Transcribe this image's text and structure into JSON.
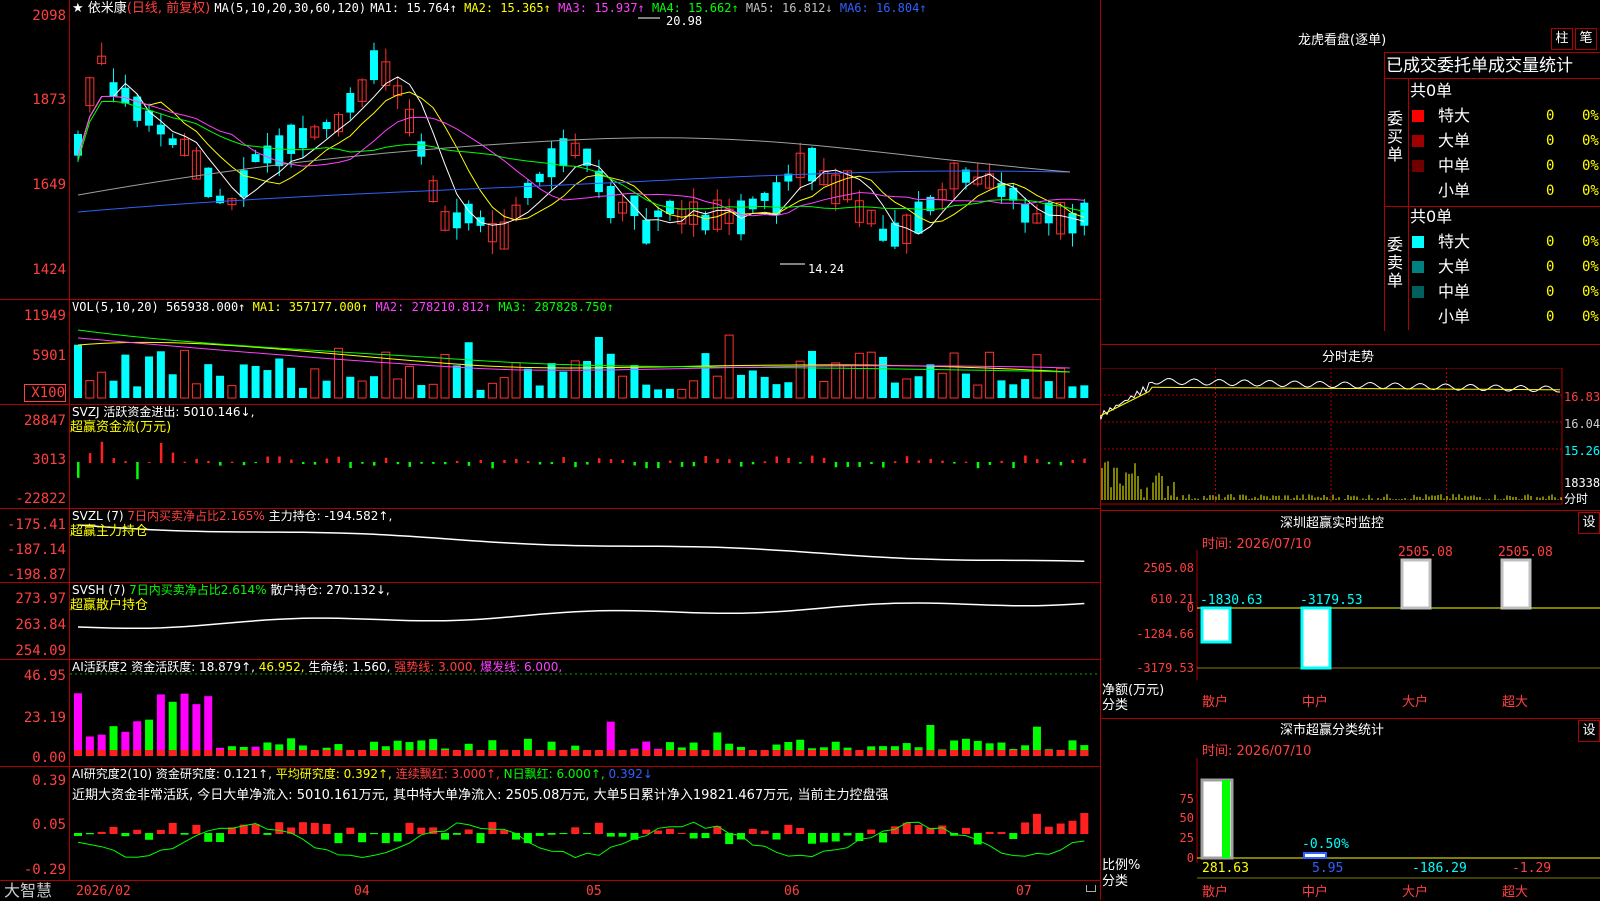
{
  "header": {
    "star": "★",
    "stock_name": "依米康",
    "mode": "(日线, 前复权)",
    "ma_label": "MA(5,10,20,30,60,120)",
    "ma_values": [
      {
        "label": "MA1:",
        "value": "15.764↑",
        "color": "#ffffff"
      },
      {
        "label": "MA2:",
        "value": "15.365↑",
        "color": "#ffff00"
      },
      {
        "label": "MA3:",
        "value": "15.937↑",
        "color": "#ff40ff"
      },
      {
        "label": "MA4:",
        "value": "15.662↑",
        "color": "#00ff00"
      },
      {
        "label": "MA5:",
        "value": "16.812↓",
        "color": "#c0c0c0"
      },
      {
        "label": "MA6:",
        "value": "16.804↑",
        "color": "#3060ff"
      }
    ],
    "high_label": "20.98",
    "low_label": "14.24"
  },
  "price_axis": [
    "2098",
    "1873",
    "1649",
    "1424"
  ],
  "vol": {
    "title": "VOL(5,10,20)",
    "value": "565938.000↑",
    "ma1": "MA1: 357177.000↑",
    "ma2": "MA2: 278210.812↑",
    "ma3": "MA3: 287828.750↑",
    "axis": [
      "11949",
      "5901",
      "X100"
    ]
  },
  "svzj": {
    "title": "SVZJ",
    "label": "活跃资金进出: 5010.146↓,",
    "sub": "超赢资金流(万元)",
    "axis": [
      "28847",
      "3013",
      "-22822"
    ]
  },
  "svzl": {
    "title": "SVZL (7)",
    "ratio": "7日内买卖净占比2.165%",
    "label": "主力持仓: -194.582↑,",
    "sub": "超赢主力持仓",
    "axis": [
      "-175.41",
      "-187.14",
      "-198.87"
    ]
  },
  "svsh": {
    "title": "SVSH (7)",
    "ratio": "7日内买卖净占比2.614%",
    "label": "散户持仓: 270.132↓,",
    "sub": "超赢散户持仓",
    "axis": [
      "273.97",
      "263.84",
      "254.09"
    ]
  },
  "ai_active": {
    "title": "AI活跃度2",
    "label": "资金活跃度: 18.879↑,",
    "v2": "46.952,",
    "life": "生命线: 1.560,",
    "strong": "强势线: 3.000,",
    "burst": "爆发线: 6.000,",
    "axis": [
      "46.95",
      "23.19",
      "0.00"
    ]
  },
  "ai_research": {
    "title": "AI研究度2(10)",
    "label": "资金研究度: 0.121↑,",
    "avg": "平均研究度: 0.392↑,",
    "cont": "连续飘红: 3.000↑,",
    "nday": "N日飘红: 6.000↑,",
    "last": "0.392↓",
    "comment": "近期大资金非常活跃, 今日大单净流入: 5010.161万元, 其中特大单净流入: 2505.08万元, 大单5日累计净入19821.467万元, 当前主力控盘强",
    "axis": [
      "0.39",
      "0.05",
      "-0.29"
    ]
  },
  "xaxis": {
    "brand": "大智慧",
    "labels": [
      "2026/02",
      "04",
      "05",
      "06",
      "07"
    ]
  },
  "dragon": {
    "title": "龙虎看盘(逐单)",
    "btn1": "柱",
    "btn2": "笔",
    "subtitle": "已成交委托单成交量统计",
    "buy_side": "委买单",
    "sell_side": "委卖单",
    "buy_total": "共0单",
    "sell_total": "共0单",
    "rows": [
      "特大",
      "大单",
      "中单",
      "小单"
    ],
    "qty": "0",
    "pct": "0%"
  },
  "intraday": {
    "title": "分时走势",
    "axis": [
      "16.83",
      "16.04",
      "15.26",
      "18338",
      "分时"
    ]
  },
  "sz_monitor": {
    "title": "深圳超赢实时监控",
    "settings": "设",
    "time": "时间: 2026/07/10",
    "axis": [
      "2505.08",
      "610.21",
      "0",
      "-1284.66",
      "-3179.53"
    ],
    "ylabel": "净额(万元)",
    "xlabel": "分类",
    "bars": [
      {
        "cat": "散户",
        "value": "-1830.63"
      },
      {
        "cat": "中户",
        "value": "-3179.53"
      },
      {
        "cat": "大户",
        "value": "2505.08"
      },
      {
        "cat": "超大",
        "value": "2505.08"
      }
    ]
  },
  "sz_class": {
    "title": "深市超赢分类统计",
    "settings": "设",
    "time": "时间: 2026/07/10",
    "axis": [
      "75",
      "50",
      "25",
      "0"
    ],
    "ylabel": "比例%",
    "xlabel": "分类",
    "mid_label": "-0.50%",
    "values": [
      "281.63",
      "5.95",
      "-186.29",
      "-1.29"
    ],
    "cats": [
      "散户",
      "中户",
      "大户",
      "超大"
    ]
  },
  "colors": {
    "up": "#ff3030",
    "down": "#00ffff",
    "border": "#b00000",
    "green": "#00ff00",
    "magenta": "#ff00ff"
  }
}
